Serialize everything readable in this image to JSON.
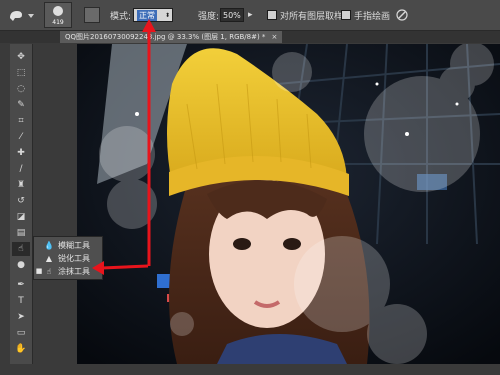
{
  "options_bar": {
    "tool_preset_icon": "smudge-finger-icon",
    "brush_size": "419",
    "mode_label": "模式:",
    "mode_value": "正常",
    "strength_label": "强度:",
    "strength_value": "50%",
    "sample_all_layers_label": "对所有图层取样",
    "finger_painting_label": "手指绘画"
  },
  "document_tab": {
    "title": "QQ图片20160730092243.jpg @ 33.3% (图层 1, RGB/8#) *",
    "close_symbol": "×"
  },
  "toolbar": {
    "tools": [
      "move-icon",
      "marquee-icon",
      "lasso-icon",
      "quick-select-icon",
      "crop-icon",
      "eyedropper-icon",
      "healing-brush-icon",
      "brush-icon",
      "clone-stamp-icon",
      "history-brush-icon",
      "eraser-icon",
      "gradient-icon",
      "smudge-icon",
      "dodge-icon",
      "pen-icon",
      "type-icon",
      "path-select-icon",
      "shape-icon",
      "hand-icon",
      "zoom-icon"
    ],
    "active_tool": "smudge-icon"
  },
  "tool_flyout": {
    "items": [
      {
        "label": "模糊工具",
        "icon": "blur-icon",
        "selected": false
      },
      {
        "label": "锐化工具",
        "icon": "sharpen-icon",
        "selected": false
      },
      {
        "label": "涂抹工具",
        "icon": "smudge-icon",
        "selected": true
      }
    ]
  },
  "annotation": {
    "arrow_color": "#e8141c"
  }
}
